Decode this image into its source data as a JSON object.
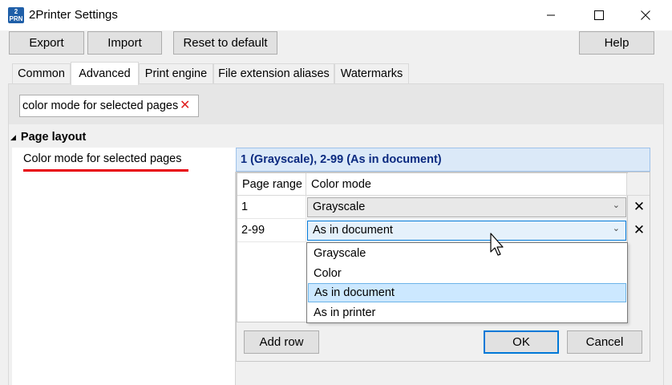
{
  "window": {
    "title": "2Printer Settings",
    "icon_text": "2\nPRN",
    "controls": [
      "minimize-icon",
      "maximize-icon",
      "close-icon"
    ]
  },
  "toolbar": {
    "export_label": "Export",
    "import_label": "Import",
    "reset_label": "Reset to default",
    "help_label": "Help"
  },
  "tabs": [
    {
      "label": "Common",
      "active": false
    },
    {
      "label": "Advanced",
      "active": true
    },
    {
      "label": "Print engine",
      "active": false
    },
    {
      "label": "File extension aliases",
      "active": false
    },
    {
      "label": "Watermarks",
      "active": false
    }
  ],
  "search": {
    "value": "color mode for selected pages",
    "clear_icon": "clear-icon"
  },
  "property_grid": {
    "category": "Page layout",
    "property_name": "Color mode for selected pages",
    "property_value": "1 (Grayscale), 2-99 (As in document)"
  },
  "editor": {
    "columns": [
      "Page range",
      "Color mode"
    ],
    "rows": [
      {
        "range": "1",
        "mode": "Grayscale"
      },
      {
        "range": "2-99",
        "mode": "As in document"
      }
    ],
    "dropdown_options": [
      "Grayscale",
      "Color",
      "As in document",
      "As in printer"
    ],
    "selected_option": "As in document",
    "add_row_label": "Add row",
    "ok_label": "OK",
    "cancel_label": "Cancel"
  },
  "colors": {
    "accent": "#0078d7",
    "value_text": "#0b2a80",
    "value_bg": "#dbe9f8",
    "underline": "#e8000b",
    "dropdown_selection": "#cce8ff"
  }
}
